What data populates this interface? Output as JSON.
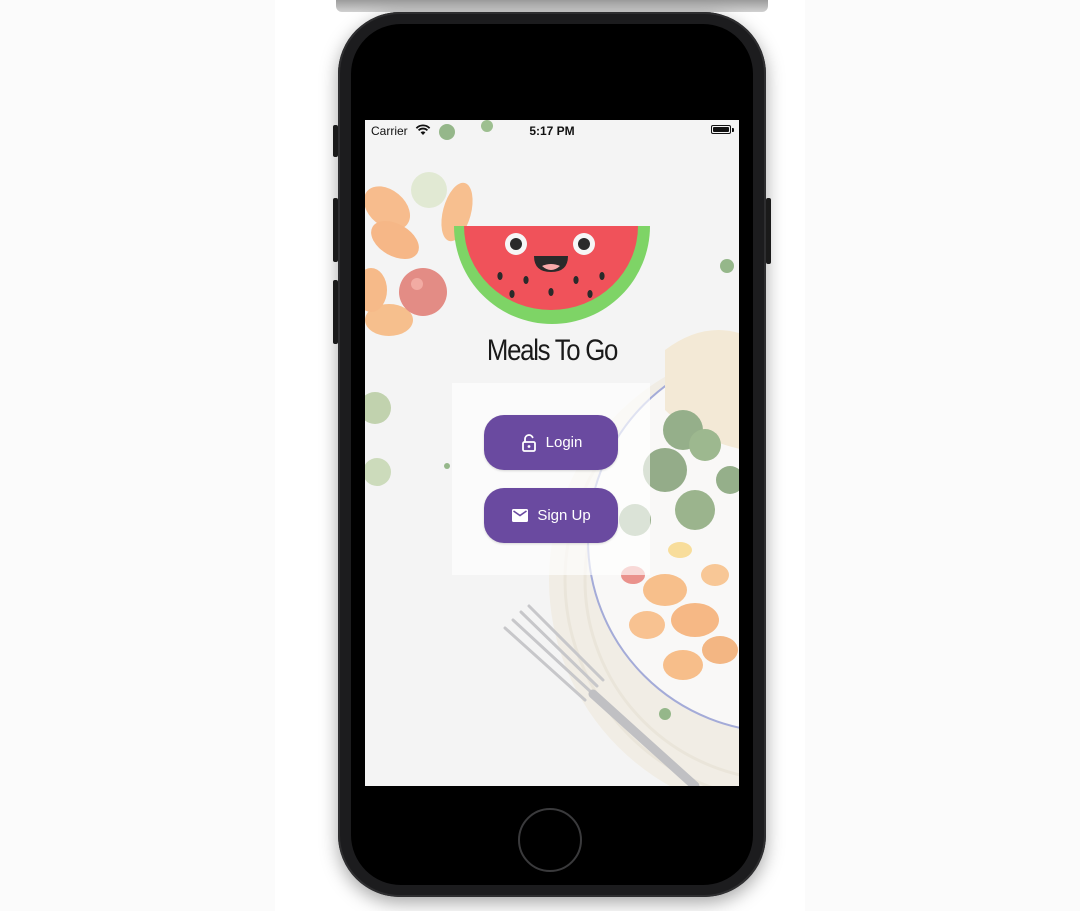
{
  "status_bar": {
    "carrier": "Carrier",
    "time": "5:17 PM",
    "icons": [
      "wifi-icon",
      "battery-icon"
    ]
  },
  "app": {
    "title": "Meals To Go",
    "logo_icon": "watermelon-icon"
  },
  "auth": {
    "login_label": "Login",
    "login_icon": "lock-open-icon",
    "signup_label": "Sign Up",
    "signup_icon": "email-icon"
  },
  "colors": {
    "button": "#6a4aa0",
    "watermelon_flesh": "#f0525a",
    "watermelon_rind": "#7ed466",
    "title_text": "#1a1a1a"
  }
}
